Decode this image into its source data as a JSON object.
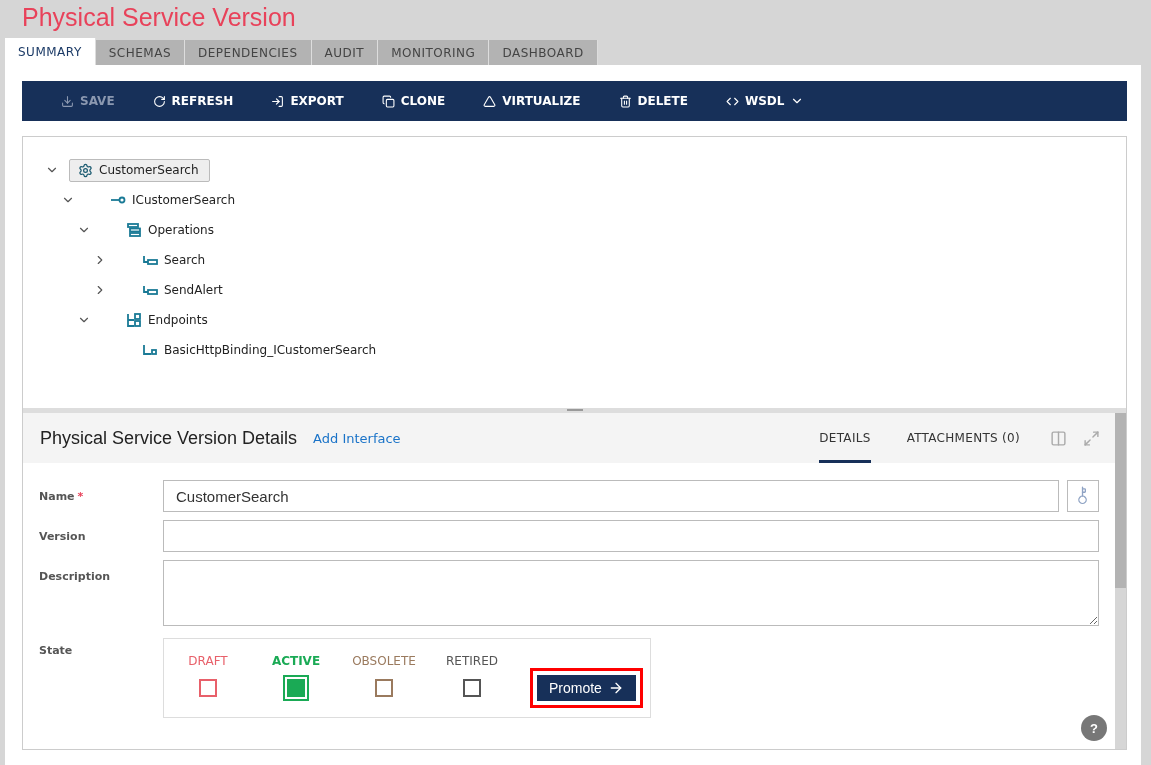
{
  "page_title": "Physical Service Version",
  "tabs": [
    {
      "label": "SUMMARY",
      "selected": true
    },
    {
      "label": "SCHEMAS",
      "selected": false
    },
    {
      "label": "DEPENDENCIES",
      "selected": false
    },
    {
      "label": "AUDIT",
      "selected": false
    },
    {
      "label": "MONITORING",
      "selected": false
    },
    {
      "label": "DASHBOARD",
      "selected": false
    }
  ],
  "toolbar": [
    {
      "kind": "save",
      "label": "SAVE",
      "disabled": true
    },
    {
      "kind": "refresh",
      "label": "REFRESH",
      "disabled": false
    },
    {
      "kind": "export",
      "label": "EXPORT",
      "disabled": false
    },
    {
      "kind": "clone",
      "label": "CLONE",
      "disabled": false
    },
    {
      "kind": "virtualize",
      "label": "VIRTUALIZE",
      "disabled": false
    },
    {
      "kind": "delete",
      "label": "DELETE",
      "disabled": false
    },
    {
      "kind": "wsdl",
      "label": "WSDL",
      "disabled": false,
      "dropdown": true
    }
  ],
  "tree": [
    {
      "kind": "service",
      "label": "CustomerSearch",
      "expanded": true,
      "selected": true,
      "children": [
        {
          "kind": "interface",
          "label": "ICustomerSearch",
          "expanded": true,
          "selected": false,
          "children": [
            {
              "kind": "operations",
              "label": "Operations",
              "expanded": true,
              "selected": false,
              "children": [
                {
                  "kind": "operation",
                  "label": "Search",
                  "expanded": false,
                  "selected": false
                },
                {
                  "kind": "operation",
                  "label": "SendAlert",
                  "expanded": false,
                  "selected": false
                }
              ]
            },
            {
              "kind": "endpoints",
              "label": "Endpoints",
              "expanded": true,
              "selected": false,
              "children": [
                {
                  "kind": "endpoint",
                  "label": "BasicHttpBinding_ICustomerSearch",
                  "selected": false
                }
              ]
            }
          ]
        }
      ]
    }
  ],
  "details": {
    "title": "Physical Service Version Details",
    "link": "Add Interface",
    "tabs": [
      {
        "label": "DETAILS",
        "selected": true
      },
      {
        "label": "ATTACHMENTS (0)",
        "selected": false
      }
    ],
    "fields": [
      {
        "kind": "text",
        "label": "Name",
        "required_mark": "*",
        "value": "CustomerSearch",
        "key_button": true
      },
      {
        "kind": "text",
        "label": "Version"
      },
      {
        "kind": "textarea",
        "label": "Description"
      }
    ],
    "state": {
      "label": "State",
      "steps": [
        {
          "label": "DRAFT",
          "color": "#e8606a",
          "selected": false
        },
        {
          "label": "ACTIVE",
          "color": "#1aaa55",
          "selected": true
        },
        {
          "label": "OBSOLETE",
          "color": "#9a7a5e",
          "selected": false
        },
        {
          "label": "RETIRED",
          "color": "#555555",
          "selected": false
        }
      ],
      "button": {
        "label": "Promote",
        "highlighted": true
      }
    }
  },
  "help": {
    "label": "?"
  }
}
